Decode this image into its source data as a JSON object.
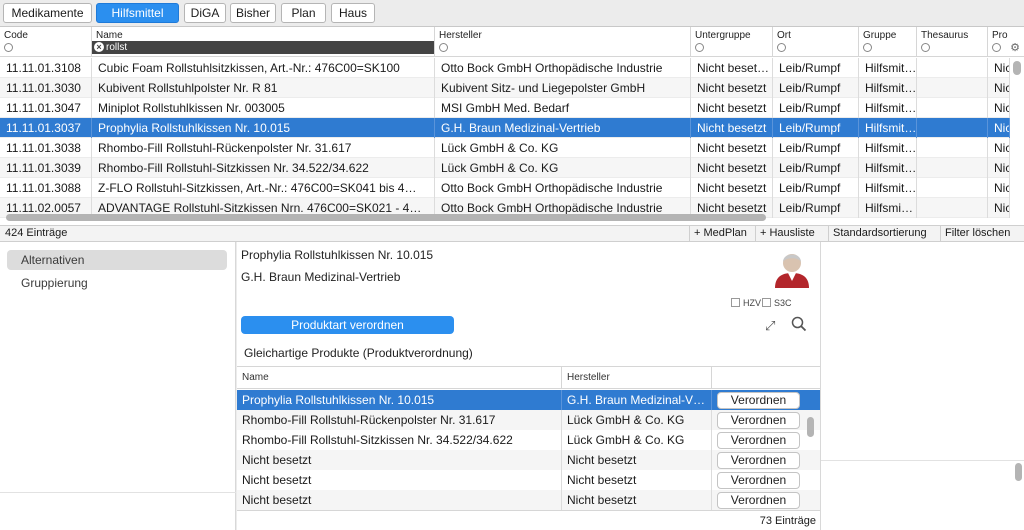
{
  "tabs": [
    "Medikamente",
    "Hilfsmittel",
    "DiGA",
    "Bisher",
    "Plan",
    "Haus"
  ],
  "columns": [
    "Code",
    "Name",
    "Hersteller",
    "Untergruppe",
    "Ort",
    "Gruppe",
    "Thesaurus",
    "Pro"
  ],
  "filter_value": "rollst",
  "rows": [
    [
      "11.11.01.3108",
      "Cubic Foam Rollstuhlsitzkissen, Art.-Nr.: 476C00=SK100",
      "Otto Bock GmbH Orthopädische Industrie",
      "Nicht beset…",
      "Leib/Rumpf",
      "Hilfsmit…",
      "",
      "Nic"
    ],
    [
      "11.11.01.3030",
      "Kubivent Rollstuhlpolster Nr. R 81",
      "Kubivent Sitz- und Liegepolster GmbH",
      "Nicht besetzt",
      "Leib/Rumpf",
      "Hilfsmit…",
      "",
      "Nic"
    ],
    [
      "11.11.01.3047",
      "Miniplot Rollstuhlkissen  Nr. 003005",
      "MSI GmbH Med. Bedarf",
      "Nicht besetzt",
      "Leib/Rumpf",
      "Hilfsmit…",
      "",
      "Nic"
    ],
    [
      "11.11.01.3037",
      "Prophylia Rollstuhlkissen Nr. 10.015",
      "G.H. Braun Medizinal-Vertrieb",
      "Nicht besetzt",
      "Leib/Rumpf",
      "Hilfsmit…",
      "",
      "Nic"
    ],
    [
      "11.11.01.3038",
      "Rhombo-Fill Rollstuhl-Rückenpolster Nr. 31.617",
      "Lück GmbH & Co. KG",
      "Nicht besetzt",
      "Leib/Rumpf",
      "Hilfsmit…",
      "",
      "Nic"
    ],
    [
      "11.11.01.3039",
      "Rhombo-Fill Rollstuhl-Sitzkissen Nr. 34.522/34.622",
      "Lück GmbH & Co. KG",
      "Nicht besetzt",
      "Leib/Rumpf",
      "Hilfsmit…",
      "",
      "Nic"
    ],
    [
      "11.11.01.3088",
      "Z-FLO Rollstuhl-Sitzkissen, Art.-Nr.: 476C00=SK041 bis 4…",
      "Otto Bock GmbH Orthopädische Industrie",
      "Nicht besetzt",
      "Leib/Rumpf",
      "Hilfsmit…",
      "",
      "Nic"
    ],
    [
      "11.11.02.0057",
      "ADVANTAGE Rollstuhl-Sitzkissen Nrn. 476C00=SK021 - 4…",
      "Otto Bock GmbH Orthopädische Industrie",
      "Nicht besetzt",
      "Leib/Rumpf",
      "Hilfsmi…",
      "",
      "Nic"
    ]
  ],
  "selected_row_index": 3,
  "status": {
    "count": "424 Einträge",
    "buttons": [
      "+ MedPlan",
      "+ Hausliste",
      "Standardsortierung",
      "Filter löschen"
    ]
  },
  "nav": [
    "Alternativen",
    "Gruppierung"
  ],
  "detail": {
    "product": "Prophylia Rollstuhlkissen Nr. 10.015",
    "manufacturer": "G.H. Braun Medizinal-Vertrieb",
    "hzv": "HZV",
    "s3c": "S3C",
    "order_type_button": "Produktart verordnen",
    "section_title": "Gleichartige Produkte (Produktverordnung)",
    "columns": [
      "Name",
      "Hersteller"
    ],
    "rows": [
      [
        "Prophylia Rollstuhlkissen Nr. 10.015",
        "G.H. Braun Medizinal-V…"
      ],
      [
        "Rhombo-Fill Rollstuhl-Rückenpolster Nr. 31.617",
        "Lück GmbH & Co. KG"
      ],
      [
        "Rhombo-Fill Rollstuhl-Sitzkissen Nr. 34.522/34.622",
        "Lück GmbH & Co. KG"
      ],
      [
        "Nicht besetzt",
        "Nicht besetzt"
      ],
      [
        "Nicht besetzt",
        "Nicht besetzt"
      ],
      [
        "Nicht besetzt",
        "Nicht besetzt"
      ]
    ],
    "row_button": "Verordnen",
    "count": "73 Einträge"
  },
  "colors": {
    "accent": "#2b8fef",
    "selection": "#2f7bd1"
  },
  "icons": [
    "clear-filter-icon",
    "settings-gear-icon",
    "doctor-avatar-icon",
    "expand-icon",
    "search-icon"
  ]
}
